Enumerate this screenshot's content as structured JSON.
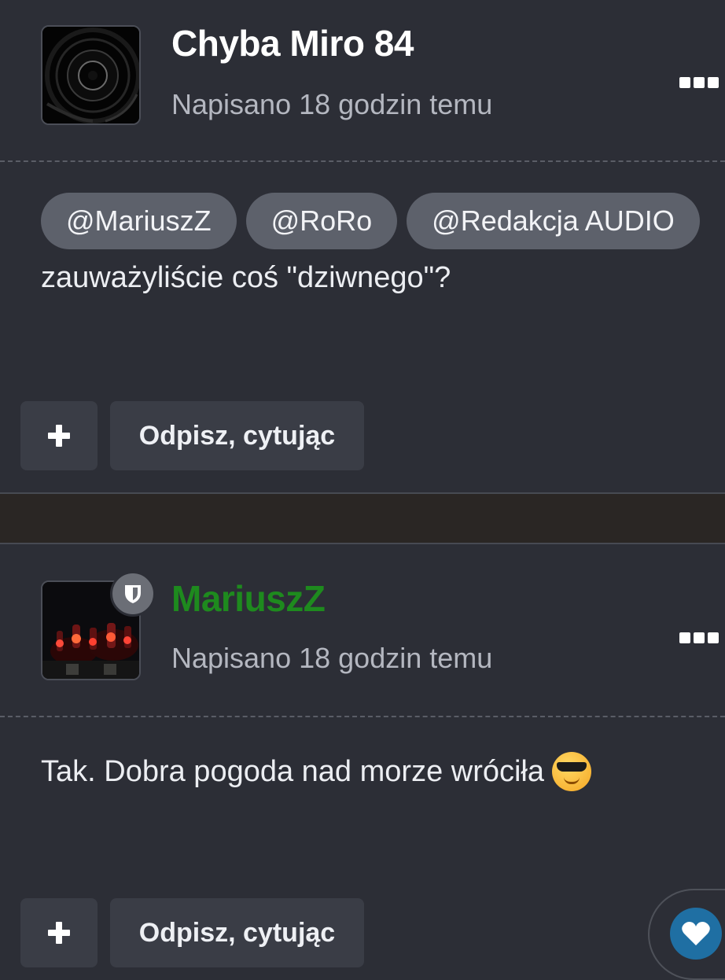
{
  "posts": [
    {
      "author": "Chyba Miro 84",
      "meta": "Napisano 18 godzin temu",
      "mentions": [
        "@MariuszZ",
        "@RoRo",
        "@Redakcja AUDIO"
      ],
      "body": "zauważyliście coś \"dziwnego\"?",
      "quote_label": "Odpisz, cytując"
    },
    {
      "author": "MariuszZ",
      "meta": "Napisano 18 godzin temu",
      "body": "Tak. Dobra pogoda nad morze wróciła",
      "quote_label": "Odpisz, cytując"
    }
  ],
  "icons": {
    "more": "more-dots-icon",
    "plus": "plus-icon",
    "badge": "shield-icon",
    "reaction": "heart-icon",
    "emoji": "sunglasses-emoji"
  },
  "colors": {
    "background": "#2c2e36",
    "author_moderator": "#1e8a1e",
    "mention_pill": "#5d616b",
    "reaction": "#1f6fa3"
  }
}
